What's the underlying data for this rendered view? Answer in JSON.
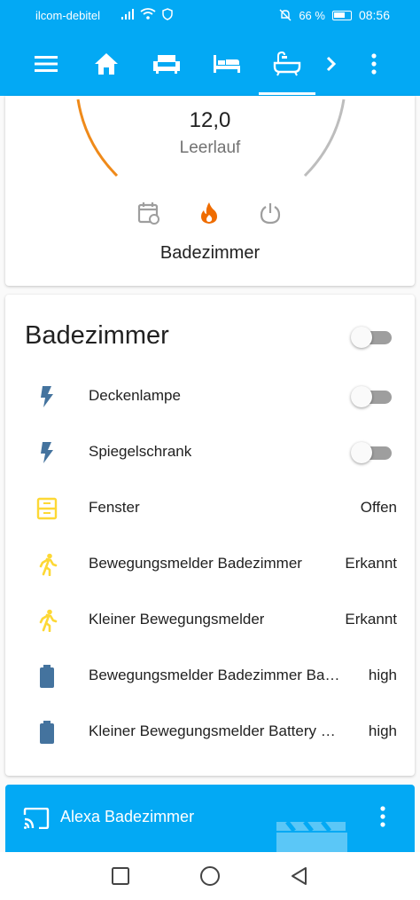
{
  "status_bar": {
    "carrier": "ilcom-debitel",
    "battery_percent": "66 %",
    "time": "08:56"
  },
  "app_bar": {
    "icons": [
      "menu-icon",
      "home-icon",
      "sofa-icon",
      "bed-icon",
      "bathtub-icon",
      "chevron-right-icon",
      "more-vertical-icon"
    ],
    "active_tab": "bathtub-icon",
    "color": "#03a9f4"
  },
  "thermostat": {
    "temperature": "12,0",
    "state": "Leerlauf",
    "name": "Badezimmer",
    "modes": [
      "calendar-sync-icon",
      "flame-icon",
      "power-icon"
    ],
    "active_mode": "flame-icon",
    "arc_color_left": "#ef8a1a",
    "arc_color_right": "#bdbdbd"
  },
  "entities_card": {
    "title": "Badezimmer",
    "rows": [
      {
        "icon": "flash-icon",
        "label": "Deckenlampe",
        "state": ""
      },
      {
        "icon": "flash-icon",
        "label": "Spiegelschrank",
        "state": ""
      },
      {
        "icon": "window-icon",
        "label": "Fenster",
        "state": "Offen"
      },
      {
        "icon": "motion-icon",
        "label": "Bewegungsmelder Badezimmer",
        "state": "Erkannt"
      },
      {
        "icon": "motion-icon",
        "label": "Kleiner Bewegungsmelder",
        "state": "Erkannt"
      },
      {
        "icon": "battery-icon",
        "label": "Bewegungsmelder Badezimmer Ba…",
        "state": "high"
      },
      {
        "icon": "battery-icon",
        "label": "Kleiner Bewegungsmelder Battery …",
        "state": "high"
      }
    ]
  },
  "media_card": {
    "title": "Alexa Badezimmer"
  },
  "nav_bar": {
    "icons": [
      "recent-apps-icon",
      "home-circle-icon",
      "back-icon"
    ]
  }
}
